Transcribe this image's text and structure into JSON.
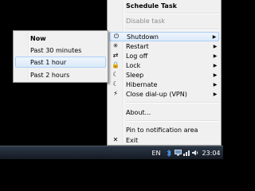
{
  "main_menu": {
    "items": [
      {
        "label": "Schedule Task",
        "icon": "",
        "style": "bold"
      },
      {
        "label": "Disable task",
        "icon": "",
        "style": "disabled"
      },
      {
        "label": "Shutdown",
        "icon": "⏻",
        "icon_name": "power-icon",
        "submenu": true,
        "state": "highlighted"
      },
      {
        "label": "Restart",
        "icon": "✳",
        "icon_name": "restart-icon",
        "submenu": true
      },
      {
        "label": "Log off",
        "icon": "⇄",
        "icon_name": "log-off-icon",
        "submenu": true
      },
      {
        "label": "Lock",
        "icon": "🔒",
        "icon_name": "lock-icon",
        "submenu": true
      },
      {
        "label": "Sleep",
        "icon": "☾",
        "icon_name": "sleep-icon",
        "submenu": true
      },
      {
        "label": "Hibernate",
        "icon": "☾",
        "icon_name": "hibernate-icon",
        "submenu": true
      },
      {
        "label": "Close dial-up (VPN)",
        "icon": "⚡",
        "icon_name": "dialup-icon",
        "submenu": true
      },
      {
        "label": "About...",
        "icon": ""
      },
      {
        "label": "Pin to notification area",
        "icon": ""
      },
      {
        "label": "Exit",
        "icon": "✕",
        "icon_name": "exit-icon"
      }
    ],
    "arrow": "▶"
  },
  "sub_menu": {
    "items": [
      {
        "label": "Now",
        "style": "bold"
      },
      {
        "label": "Past 30 minutes"
      },
      {
        "label": "Past 1 hour",
        "state": "highlighted"
      },
      {
        "label": "Past 2 hours"
      }
    ]
  },
  "taskbar": {
    "language": "EN",
    "clock": "23:04",
    "tray_icons": [
      "bluetooth-icon",
      "monitor-icon",
      "network-icon",
      "volume-icon"
    ]
  },
  "colors": {
    "menu_bg": "#f0f0f0",
    "highlight_border": "#aecff7",
    "desktop_bg": "#000000",
    "taskbar_bg": "#1c2430"
  }
}
